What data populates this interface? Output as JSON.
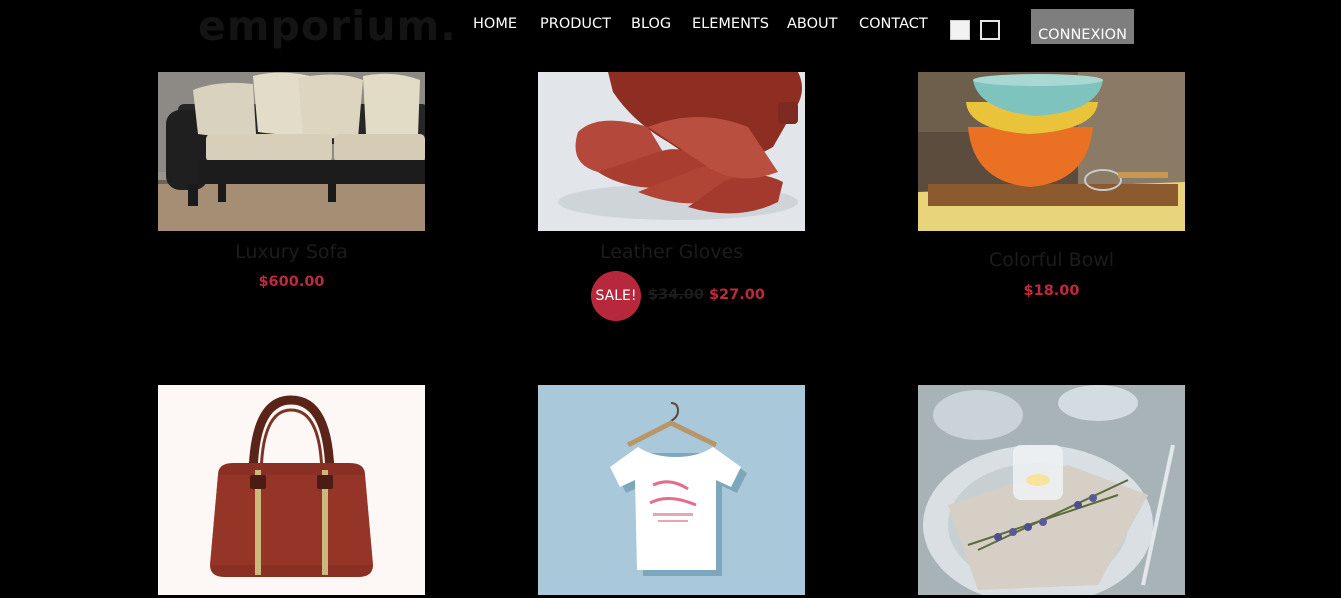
{
  "header": {
    "logo": "emporium.",
    "nav": [
      {
        "label": "HOME"
      },
      {
        "label": "PRODUCT"
      },
      {
        "label": "BLOG"
      },
      {
        "label": "ELEMENTS"
      },
      {
        "label": "ABOUT"
      },
      {
        "label": "CONTACT"
      }
    ],
    "connexion_label": "CONNEXION"
  },
  "products": [
    {
      "name": "Luxury Sofa",
      "price": "$600.00"
    },
    {
      "name": "Leather Gloves",
      "sale_badge": "SALE!",
      "old_price": "$34.00",
      "price": "$27.00"
    },
    {
      "name": "Colorful Bowl",
      "price": "$18.00"
    },
    {
      "name": "",
      "price": ""
    },
    {
      "name": "",
      "price": ""
    },
    {
      "name": "",
      "price": ""
    }
  ],
  "colors": {
    "background": "#000000",
    "price": "#c0283d",
    "sale_badge": "#b8283d",
    "product_name": "#1c1c1c",
    "connexion_button": "#7e7e7e"
  }
}
